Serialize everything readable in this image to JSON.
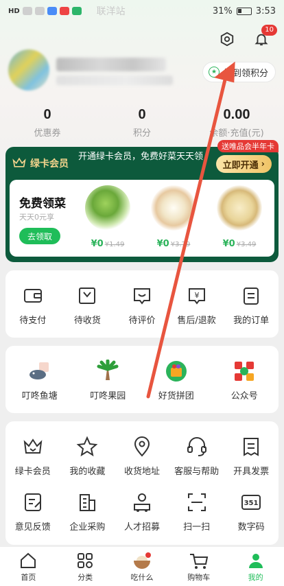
{
  "status_bar": {
    "left_label": "HD",
    "station": "联洋站",
    "battery": "31%",
    "time": "3:53"
  },
  "header": {
    "notification_count": "10"
  },
  "profile": {
    "checkin_label": "签到领积分"
  },
  "stats": [
    {
      "value": "0",
      "label": "优惠券"
    },
    {
      "value": "0",
      "label": "积分"
    },
    {
      "value": "0.00",
      "label": "余额·充值(元)"
    }
  ],
  "member": {
    "title": "绿卡会员",
    "desc": "开通绿卡会员，免费好菜天天领",
    "open_label": "立即开通",
    "promo": "送唯品会半年卡",
    "free_title": "免费领菜",
    "free_sub": "天天0元享",
    "get_label": "去领取",
    "items": [
      {
        "price": "¥0",
        "orig": "¥1.49"
      },
      {
        "price": "¥0",
        "orig": "¥3.79"
      },
      {
        "price": "¥0",
        "orig": "¥3.49"
      }
    ]
  },
  "orders": [
    {
      "label": "待支付",
      "icon": "wallet-icon"
    },
    {
      "label": "待收货",
      "icon": "package-icon"
    },
    {
      "label": "待评价",
      "icon": "comment-icon"
    },
    {
      "label": "售后/退款",
      "icon": "refund-icon"
    },
    {
      "label": "我的订单",
      "icon": "order-list-icon"
    }
  ],
  "features": [
    {
      "label": "叮咚鱼塘",
      "icon": "fish-pond-icon"
    },
    {
      "label": "叮咚果园",
      "icon": "orchard-icon"
    },
    {
      "label": "好货拼团",
      "icon": "group-buy-icon"
    },
    {
      "label": "公众号",
      "icon": "official-account-icon"
    }
  ],
  "services_row1": [
    {
      "label": "绿卡会员",
      "icon": "crown-icon"
    },
    {
      "label": "我的收藏",
      "icon": "star-icon"
    },
    {
      "label": "收货地址",
      "icon": "location-icon"
    },
    {
      "label": "客服与帮助",
      "icon": "headset-icon"
    },
    {
      "label": "开具发票",
      "icon": "invoice-icon"
    }
  ],
  "services_row2": [
    {
      "label": "意见反馈",
      "icon": "feedback-icon"
    },
    {
      "label": "企业采购",
      "icon": "building-icon"
    },
    {
      "label": "人才招募",
      "icon": "recruit-icon"
    },
    {
      "label": "扫一扫",
      "icon": "scan-icon"
    },
    {
      "label": "数字码",
      "icon": "digit-code-icon"
    }
  ],
  "bottom_nav": [
    {
      "label": "首页",
      "icon": "home-icon"
    },
    {
      "label": "分类",
      "icon": "category-icon"
    },
    {
      "label": "吃什么",
      "icon": "bowl-icon"
    },
    {
      "label": "购物车",
      "icon": "cart-icon"
    },
    {
      "label": "我的",
      "icon": "profile-icon"
    }
  ],
  "colors": {
    "brand_green": "#1fbd59",
    "member_green": "#0d5a3c",
    "arrow_red": "#e8553f",
    "badge_red": "#e53935"
  }
}
